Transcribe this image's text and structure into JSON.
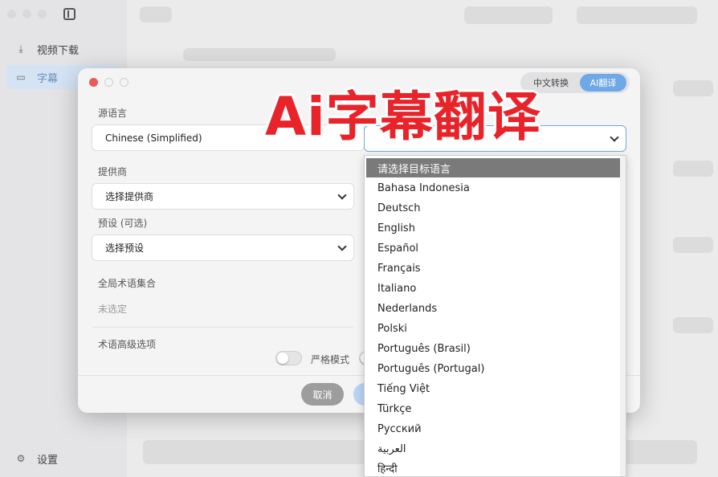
{
  "sidebar": {
    "items": [
      {
        "label": "视频下载",
        "icon": "download-icon"
      },
      {
        "label": "字幕",
        "icon": "subtitle-icon"
      }
    ],
    "settings_label": "设置"
  },
  "modal": {
    "mode_tabs": {
      "chinese_convert": "中文转换",
      "ai_translate": "AI翻译"
    },
    "source_language": {
      "label": "源语言",
      "value": "Chinese (Simplified)"
    },
    "provider": {
      "label": "提供商",
      "value": "选择提供商"
    },
    "preset": {
      "label": "预设 (可选)",
      "value": "选择预设"
    },
    "glossary": {
      "label": "全局术语集合",
      "value": "未选定"
    },
    "glossary_advanced": {
      "label": "术语高级选项",
      "strict_label": "严格模式"
    },
    "buttons": {
      "cancel": "取消"
    }
  },
  "overlay_title": "Ai字幕翻译",
  "target_language": {
    "options": [
      "请选择目标语言",
      "Bahasa Indonesia",
      "Deutsch",
      "English",
      "Español",
      "Français",
      "Italiano",
      "Nederlands",
      "Polski",
      "Português (Brasil)",
      "Português (Portugal)",
      "Tiếng Việt",
      "Türkçe",
      "Русский",
      "العربية",
      "हिन्दी"
    ]
  }
}
